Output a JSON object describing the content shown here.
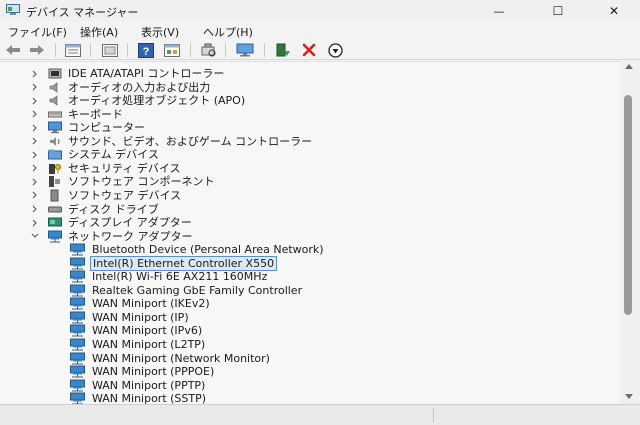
{
  "window": {
    "title": "デバイス マネージャー",
    "controls": {
      "minimize": "—",
      "maximize": "☐",
      "close": "✕"
    }
  },
  "menu": [
    {
      "label": "ファイル(F)"
    },
    {
      "label": "操作(A)"
    },
    {
      "label": "表示(V)"
    },
    {
      "label": "ヘルプ(H)"
    }
  ],
  "toolbar": [
    "back-arrow-icon",
    "forward-arrow-icon",
    "properties-icon",
    "show-hidden-icon",
    "help-icon",
    "view-icon",
    "scan-hardware-icon",
    "monitor-icon",
    "update-driver-icon",
    "uninstall-icon",
    "disable-icon"
  ],
  "tree": {
    "categories": [
      {
        "label": "IDE ATA/ATAPI コントローラー",
        "icon": "ide-controller-icon",
        "expanded": false
      },
      {
        "label": "オーディオの入力および出力",
        "icon": "speaker-icon",
        "expanded": false
      },
      {
        "label": "オーディオ処理オブジェクト (APO)",
        "icon": "speaker-icon",
        "expanded": false
      },
      {
        "label": "キーボード",
        "icon": "keyboard-icon",
        "expanded": false
      },
      {
        "label": "コンピューター",
        "icon": "computer-icon",
        "expanded": false
      },
      {
        "label": "サウンド、ビデオ、およびゲーム コントローラー",
        "icon": "sound-icon",
        "expanded": false
      },
      {
        "label": "システム デバイス",
        "icon": "system-folder-icon",
        "expanded": false
      },
      {
        "label": "セキュリティ デバイス",
        "icon": "security-key-icon",
        "expanded": false
      },
      {
        "label": "ソフトウェア コンポーネント",
        "icon": "software-component-icon",
        "expanded": false
      },
      {
        "label": "ソフトウェア デバイス",
        "icon": "software-device-icon",
        "expanded": false
      },
      {
        "label": "ディスク ドライブ",
        "icon": "disk-drive-icon",
        "expanded": false
      },
      {
        "label": "ディスプレイ アダプター",
        "icon": "display-adapter-icon",
        "expanded": false
      },
      {
        "label": "ネットワーク アダプター",
        "icon": "network-adapter-icon",
        "expanded": true
      }
    ],
    "network_devices": [
      {
        "label": "Bluetooth Device (Personal Area Network)",
        "selected": false
      },
      {
        "label": "Intel(R) Ethernet Controller X550",
        "selected": true
      },
      {
        "label": "Intel(R) Wi-Fi 6E AX211 160MHz",
        "selected": false
      },
      {
        "label": "Realtek Gaming GbE Family Controller",
        "selected": false
      },
      {
        "label": "WAN Miniport (IKEv2)",
        "selected": false
      },
      {
        "label": "WAN Miniport (IP)",
        "selected": false
      },
      {
        "label": "WAN Miniport (IPv6)",
        "selected": false
      },
      {
        "label": "WAN Miniport (L2TP)",
        "selected": false
      },
      {
        "label": "WAN Miniport (Network Monitor)",
        "selected": false
      },
      {
        "label": "WAN Miniport (PPPOE)",
        "selected": false
      },
      {
        "label": "WAN Miniport (PPTP)",
        "selected": false
      },
      {
        "label": "WAN Miniport (SSTP)",
        "selected": false
      }
    ]
  },
  "colors": {
    "selection_border": "#5b8ecf",
    "selection_fill": "#dce8f7",
    "network_icon": "#3a86c8",
    "uninstall_red": "#d42020"
  }
}
